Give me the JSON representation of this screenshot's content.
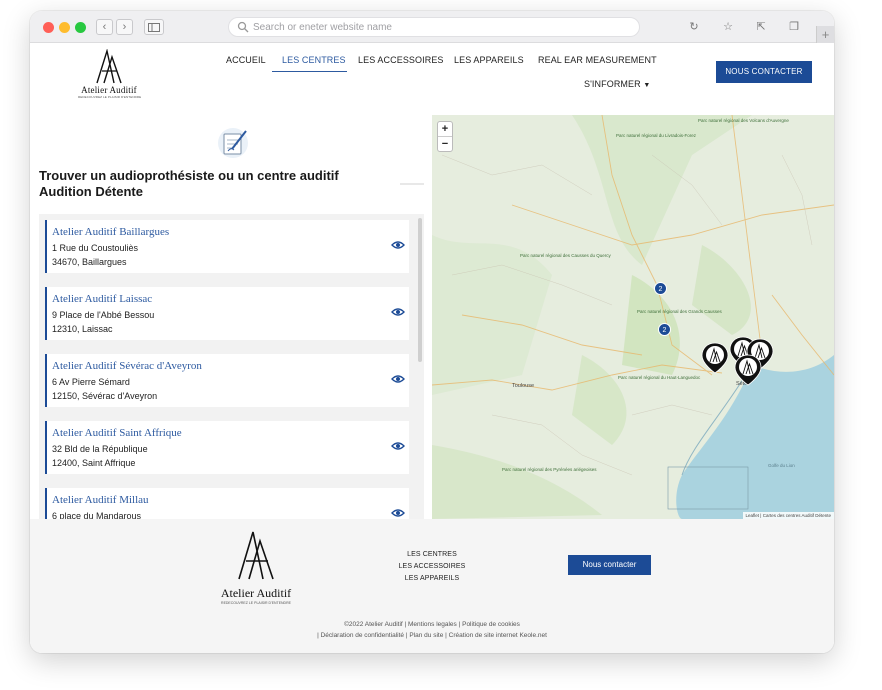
{
  "browser": {
    "search_placeholder": "Search or eneter website name",
    "colors": {
      "close": "#ff5f57",
      "minimize": "#febc2e",
      "maximize": "#28c840"
    },
    "icons": [
      "back-icon",
      "forward-icon",
      "sidebar-icon",
      "search-icon",
      "reload-icon",
      "bookmark-icon",
      "share-icon",
      "tabs-icon",
      "new-tab-icon"
    ]
  },
  "brand": {
    "name": "Atelier Auditif",
    "tagline": "REDECOUVREZ LE PLAISIR D'ENTENDRE"
  },
  "nav": {
    "items": [
      "ACCUEIL",
      "LES CENTRES",
      "LES ACCESSOIRES",
      "LES APPAREILS",
      "REAL EAR MEASUREMENT"
    ],
    "sub_item": "S'INFORMER",
    "active": "LES CENTRES",
    "cta": "NOUS CONTACTER"
  },
  "finder": {
    "title_line1": "Trouver un audioprothésiste ou un centre auditif",
    "title_line2": "Audition Détente",
    "centers": [
      {
        "name": "Atelier Auditif Baillargues",
        "street": "1 Rue du Coustouliès",
        "city": "34670, Baillargues"
      },
      {
        "name": "Atelier Auditif Laissac",
        "street": "9 Place de l'Abbé Bessou",
        "city": "12310, Laissac"
      },
      {
        "name": "Atelier Auditif Sévérac d'Aveyron",
        "street": "6 Av Pierre Sémard",
        "city": "12150, Sévérac d'Aveyron"
      },
      {
        "name": "Atelier Auditif Saint Affrique",
        "street": "32 Bld de la République",
        "city": "12400, Saint Affrique"
      },
      {
        "name": "Atelier Auditif Millau",
        "street": "6 place du Mandarous",
        "city": ""
      }
    ]
  },
  "map": {
    "zoom_in": "+",
    "zoom_out": "−",
    "clusters": [
      "2",
      "2"
    ],
    "cities": [
      "Toulouse",
      "Sète"
    ],
    "parks": [
      "Parc naturel régional des Volcans d'Auvergne",
      "Parc naturel régional du Livradois-Forez",
      "Parc naturel régional des Causses du Quercy",
      "Parc naturel régional des Grands Causses",
      "Parc naturel régional du Haut-Languedoc",
      "Parc naturel régional des Pyrénées ariégeoises",
      "Golfe du Lion"
    ],
    "attribution": "Leaflet | Cartes des centres Auditif Détente"
  },
  "footer": {
    "links": [
      "LES CENTRES",
      "LES ACCESSOIRES",
      "LES APPAREILS"
    ],
    "cta": "Nous contacter",
    "legal_line1": [
      "©2022 Atelier Auditif",
      "Mentions legales",
      "Politique de cookies"
    ],
    "legal_line2": [
      "Déclaration de confidentialité",
      "Plan du site",
      "Création de site internet Keole.net"
    ]
  }
}
